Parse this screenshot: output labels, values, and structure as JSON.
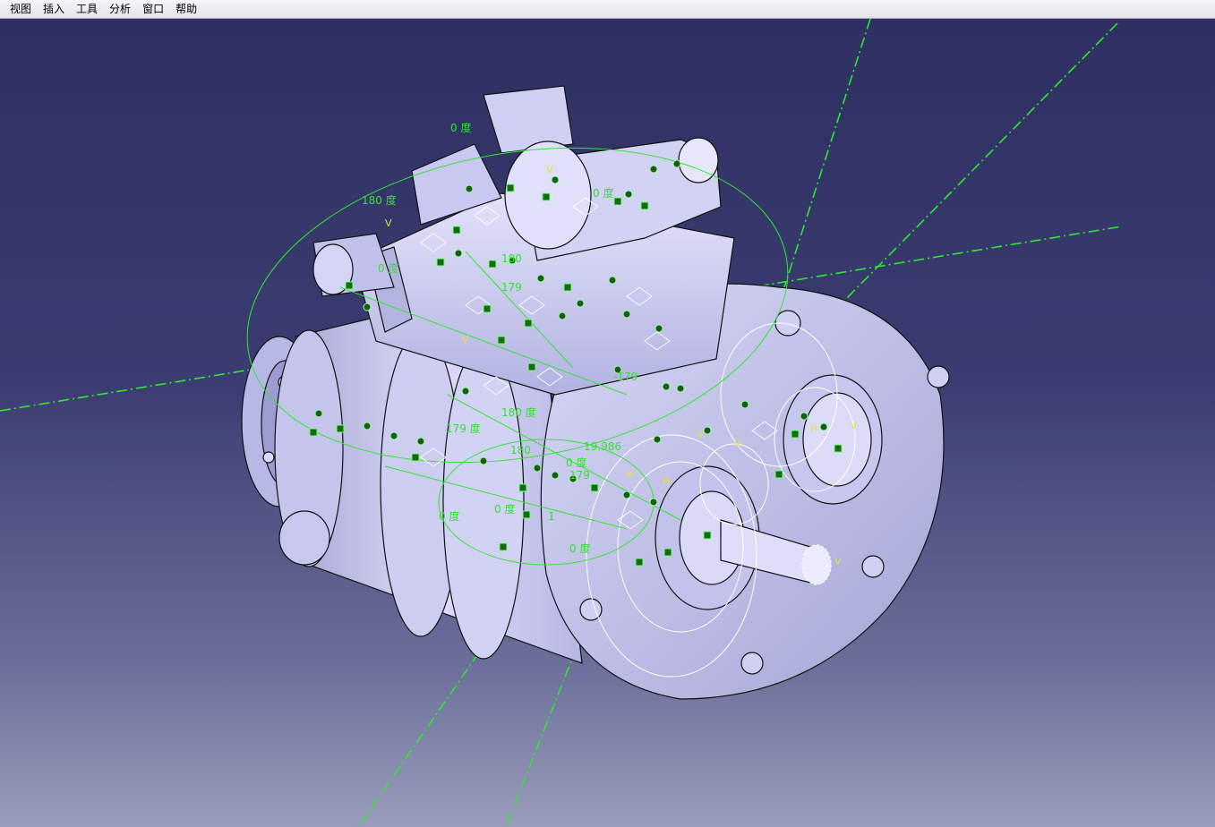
{
  "menubar": {
    "items": [
      {
        "id": "view",
        "label": "视图"
      },
      {
        "id": "insert",
        "label": "插入"
      },
      {
        "id": "tools",
        "label": "工具"
      },
      {
        "id": "analyze",
        "label": "分析"
      },
      {
        "id": "window",
        "label": "窗口"
      },
      {
        "id": "help",
        "label": "帮助"
      }
    ]
  },
  "viewport": {
    "background_top": "#2e3062",
    "background_bottom": "#9a9cbb",
    "model_color": "#c9c9ef",
    "constraint_color": "#35e035",
    "symbol_color": "#e6e23a",
    "annotations": {
      "a1": "180 度",
      "a2": "0 度",
      "a3": "0 度",
      "a4": "180",
      "a5": "180 度",
      "a6": "179 度",
      "a7": "19.986",
      "a8": "0 度",
      "a9": "0 度",
      "a10": "0 度",
      "a11": "179",
      "a12": "180",
      "a13": "0 度",
      "a14": "-179",
      "a15": "179",
      "a16": "0 度",
      "a17": "1"
    },
    "symbols": {
      "s1": "V",
      "s2": "V",
      "s3": "V",
      "s4": "H",
      "s5": "H",
      "s6": "V",
      "s7": "V",
      "s8": "V",
      "s9": "H",
      "s10": "V"
    }
  }
}
